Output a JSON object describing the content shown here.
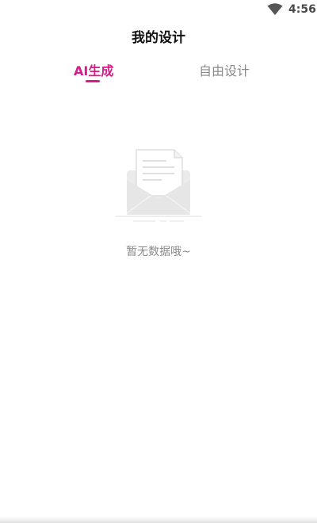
{
  "status_bar": {
    "time": "4:56",
    "wifi_icon": "wifi-icon"
  },
  "header": {
    "title": "我的设计"
  },
  "tabs": [
    {
      "label": "AI生成",
      "active": true
    },
    {
      "label": "自由设计",
      "active": false
    }
  ],
  "empty_state": {
    "icon": "empty-envelope-icon",
    "message": "暂无数据哦~"
  },
  "colors": {
    "accent": "#d81b8a",
    "inactive_text": "#8a8a8a",
    "title_text": "#111111"
  }
}
